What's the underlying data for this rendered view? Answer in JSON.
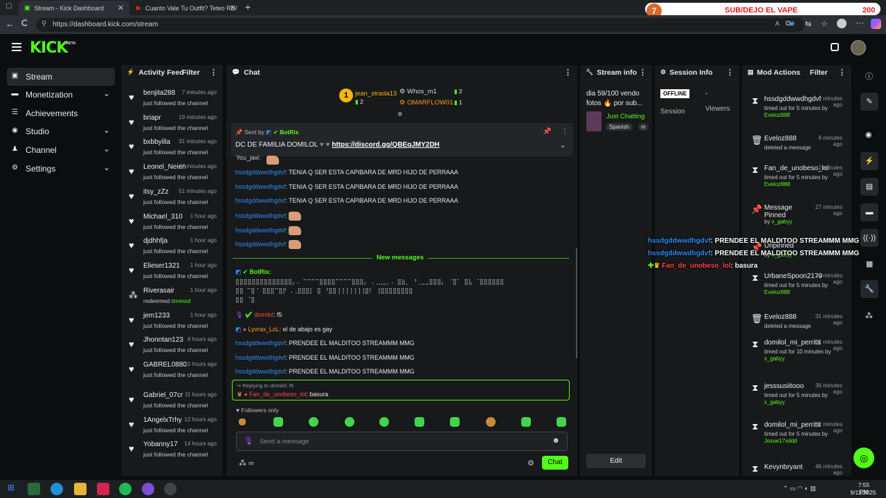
{
  "browser": {
    "tabs": [
      {
        "title": "Stream - Kick Dashboard",
        "active": true
      },
      {
        "title": "Cuanto Vale Tu Outfit? Teteo RD/",
        "active": false
      }
    ],
    "url": "https://dashboard.kick.com/stream",
    "overlay_count": "7",
    "overlay_title": "SUB/DEJO EL VAPE",
    "overlay_score": "200"
  },
  "app": {
    "logo": "KICK",
    "beta": "BETA"
  },
  "nav": [
    {
      "label": "Stream",
      "icon": "stream-icon",
      "active": true,
      "chevron": false
    },
    {
      "label": "Monetization",
      "icon": "monetization-icon",
      "active": false,
      "chevron": true
    },
    {
      "label": "Achievements",
      "icon": "achievements-icon",
      "active": false,
      "chevron": false
    },
    {
      "label": "Studio",
      "icon": "studio-icon",
      "active": false,
      "chevron": true
    },
    {
      "label": "Channel",
      "icon": "channel-icon",
      "active": false,
      "chevron": true
    },
    {
      "label": "Settings",
      "icon": "settings-icon",
      "active": false,
      "chevron": true
    }
  ],
  "activity": {
    "title": "Activity Feed",
    "filter": "Filter",
    "items": [
      {
        "name": "benjita288",
        "time": "7 minutes ago",
        "action": "just followed the channel"
      },
      {
        "name": "briapr",
        "time": "19 minutes ago",
        "action": "just followed the channel"
      },
      {
        "name": "bxbbyilla",
        "time": "31 minutes ago",
        "action": "just followed the channel"
      },
      {
        "name": "Leonel_Neien",
        "time": "47 minutes ago",
        "action": "just followed the channel"
      },
      {
        "name": "itsy_zZz",
        "time": "51 minutes ago",
        "action": "just followed the channel"
      },
      {
        "name": "Michael_310",
        "time": "1 hour ago",
        "action": "just followed the channel"
      },
      {
        "name": "djdhhfja",
        "time": "1 hour ago",
        "action": "just followed the channel"
      },
      {
        "name": "Elieser1321",
        "time": "1 hour ago",
        "action": "just followed the channel"
      },
      {
        "name": "Riverasair",
        "time": "1 hour ago",
        "action": "redeemed",
        "extra": "timeout"
      },
      {
        "name": "jem1233",
        "time": "1 hour ago",
        "action": "just followed the channel"
      },
      {
        "name": "Jhonntan123",
        "time": "4 hours ago",
        "action": "just followed the channel"
      },
      {
        "name": "GABREL0880",
        "time": "10 hours ago",
        "action": "just followed the channel"
      },
      {
        "name": "Gabriel_07cr",
        "time": "11 hours ago",
        "action": "just followed the channel"
      },
      {
        "name": "1AngelxTrhy",
        "time": "12 hours ago",
        "action": "just followed the channel"
      },
      {
        "name": "Yobanny17",
        "time": "14 hours ago",
        "action": "just followed the channel"
      }
    ]
  },
  "chat": {
    "title": "Chat",
    "leaderboard": {
      "rank": "1",
      "first": {
        "name": "jean_strada13",
        "count": "2"
      },
      "second": {
        "name": "Whos_m1",
        "count": "2"
      },
      "third": {
        "name": "OMARFLOW01",
        "count": "1"
      }
    },
    "pinned": {
      "sent_by": "Sent by",
      "sender": "BotRix",
      "text": "DC DE FAMILIA DOMILOL",
      "link": "https://discord.gg/QBEqJMY2DH"
    },
    "partial_user": "You_javi:",
    "messages": [
      {
        "user": "hssdgddwwdhgdvf",
        "text": "TENIA Q SER ESTA CAPIBARA DE MRD HIJO DE PERRAAA"
      },
      {
        "user": "hssdgddwwdhgdvf",
        "text": "TENIA Q SER ESTA CAPIBARA DE MRD HIJO DE PERRAAA"
      },
      {
        "user": "hssdgddwwdhgdvf",
        "text": "TENIA Q SER ESTA CAPIBARA DE MRD HIJO DE PERRAAA"
      },
      {
        "user": "hssdgddwwdhgdvf",
        "text": ""
      },
      {
        "user": "hssdgddwwdhgdvf",
        "text": ""
      },
      {
        "user": "hssdgddwwdhgdvf",
        "text": ""
      }
    ],
    "new_messages": "New messages",
    "botrix_user": "BotRix:",
    "ascii_line1": "⣿⣿⣿⣿⣿⣿⣿⣿⣿⣿⣿⣿⣿⣿⡄.    ⠉⠉⠉⠉⣿⣿⣿⣿⠉⠉⠉⠉⣿⣿⣿⡄  .⢀⣀⣀⡀.  ⣿⣷⡀ ⠘⢀⣀⣀⣿⣿⣿⡄   ⠈⣿⠁   ⣿⣧ ⠈⣿⣿⣿⣿⣿⣿",
    "ascii_line2": "⣿⣿       ⠉⣿⠈ ⣿⣿⣿⠉⣿⡟        .⢀⣿⣿⣿⡇ ⣿     ⠘⣿⣿⢸⢸⢸⢸⢸⢸⢸⣿⠇       ⢸⣿⣿⣿⣿⣿⣿⣿⣿",
    "ascii_line3": "⣿⣿          ⠈⣿",
    "messages2": [
      {
        "user": "domilol",
        "text": "f5"
      },
      {
        "user": "Lyvrax_LoL",
        "text": "el de abajo es gay"
      },
      {
        "user": "hssdgddwwdhgdvf",
        "text": "PRENDEE EL MALDITOO STREAMMM MMG"
      },
      {
        "user": "hssdgddwwdhgdvf",
        "text": "PRENDEE EL MALDITOO STREAMMM MMG"
      },
      {
        "user": "hssdgddwwdhgdvf",
        "text": "PRENDEE EL MALDITOO STREAMMM MMG"
      }
    ],
    "reply_context": "Replying to domilol: f5",
    "reply_user": "Fan_de_unobeso_lol",
    "reply_text": "basura",
    "followers_only": "Followers only",
    "input_placeholder": "Send a message",
    "send_label": "Chat"
  },
  "stream_info": {
    "title": "Stream info",
    "stream_title": "dia 59/100 vendo fotos 🔥 por sub...",
    "category": "Just Chatting",
    "tags": [
      "Spanish",
      "m"
    ],
    "edit_label": "Edit"
  },
  "session": {
    "title": "Session Info",
    "status": "OFFLINE",
    "status_label": "Session",
    "viewers_value": "-",
    "viewers_label": "Viewers"
  },
  "mod": {
    "title": "Mod Actions",
    "filter": "Filter",
    "items": [
      {
        "icon": "hourglass-icon",
        "name": "hssdgddwwdhgdvf",
        "time": "1 minutes ago",
        "desc": "timed out for 5 minutes by",
        "by": "Eveloz888"
      },
      {
        "icon": "trash-icon",
        "name": "Eveloz888",
        "time": "8 minutes ago",
        "desc": "deleted a message",
        "by": ""
      },
      {
        "icon": "hourglass-icon",
        "name": "Fan_de_unobeso_lol",
        "time": "2 minutes ago",
        "desc": "timed out for 5 minutes by",
        "by": "Eveloz888"
      },
      {
        "icon": "pin-icon",
        "name": "Message Pinned",
        "time": "27 minutes ago",
        "desc": "by",
        "by": "x_gabyy"
      },
      {
        "icon": "pin-icon",
        "name": "Unpinned",
        "time": "",
        "desc": "by",
        "by": "x_gabyy"
      },
      {
        "icon": "hourglass-icon",
        "name": "UrbaneSpoon2179",
        "time": "30 minutes ago",
        "desc": "timed out for 5 minutes by",
        "by": "Eveloz888"
      },
      {
        "icon": "trash-icon",
        "name": "Eveloz888",
        "time": "31 minutes ago",
        "desc": "deleted a message",
        "by": ""
      },
      {
        "icon": "hourglass-icon",
        "name": "domilol_mi_perrita",
        "time": "32 minutes ago",
        "desc": "timed out for 10 minutes by",
        "by": "x_gabyy"
      },
      {
        "icon": "hourglass-icon",
        "name": "jesssusiitooo",
        "time": "36 minutes ago",
        "desc": "timed out for 5 minutes by",
        "by": "x_gabyy"
      },
      {
        "icon": "hourglass-icon",
        "name": "domilol_mi_perrita",
        "time": "42 minutes ago",
        "desc": "timed out for 5 minutes by",
        "by": "Josue17xddd"
      },
      {
        "icon": "hourglass-icon",
        "name": "Kevynbryant",
        "time": "46 minutes ago",
        "desc": "",
        "by": ""
      }
    ]
  },
  "overlay_chat": [
    {
      "user": "hssdgddwwdhgdvf",
      "text": ": PRENDEE EL MALDITOO STREAMMM MMG"
    },
    {
      "user": "hssdgddwwdhgdvf",
      "text": ": PRENDEE EL MALDITOO STREAMMM MMG"
    },
    {
      "user": "Fan_de_unobeso_lol",
      "text": ": basura"
    }
  ],
  "taskbar": {
    "time": "7:55 PM",
    "date": "9/11/2025"
  },
  "colors": {
    "accent": "#53fc18",
    "panel": "#17191b",
    "background": "#0b0e0f",
    "user_blue": "#2f8df5"
  }
}
